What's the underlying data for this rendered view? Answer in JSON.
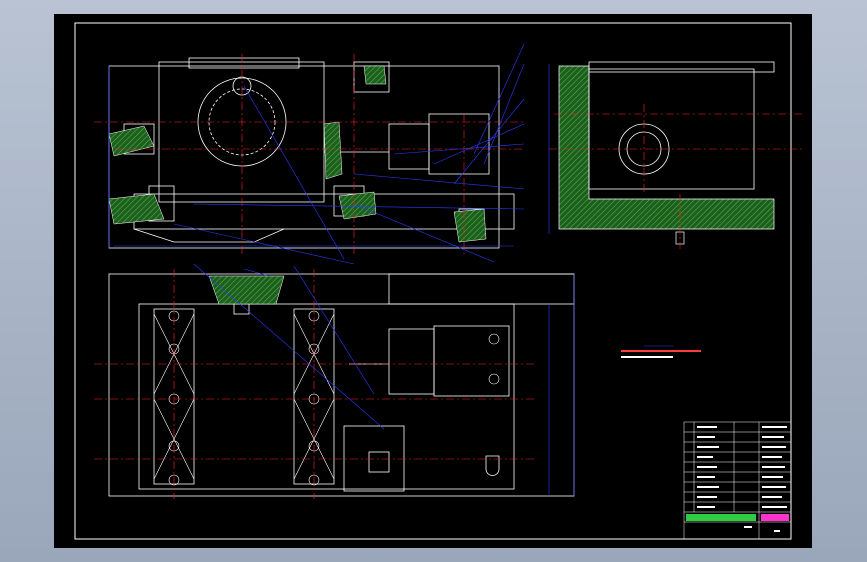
{
  "drawing": {
    "background": "#000000",
    "outline_color": "#ffffff",
    "centerline_color": "#ff2020",
    "dimension_color": "#2a3cff",
    "section_color": "#2e8b2e"
  },
  "title_block": {
    "rows": 11,
    "logo_colors": [
      "#2ecc40",
      "#ff33cc"
    ]
  }
}
